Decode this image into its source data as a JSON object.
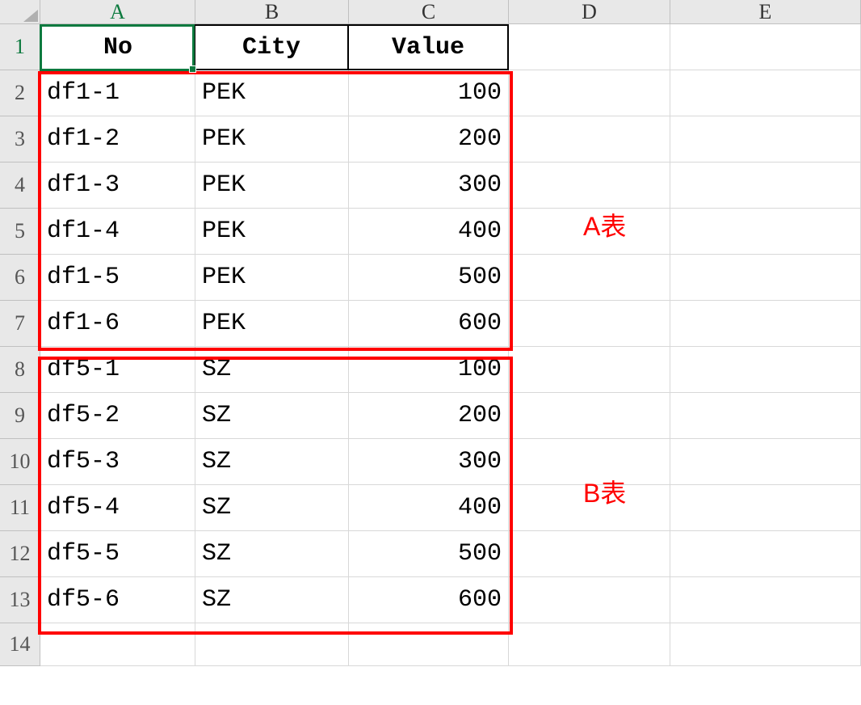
{
  "columns": [
    "A",
    "B",
    "C",
    "D",
    "E"
  ],
  "activeColumn": "A",
  "activeRow": 1,
  "headers": {
    "no": "No",
    "city": "City",
    "value": "Value"
  },
  "rows": [
    {
      "rownum": "1"
    },
    {
      "rownum": "2",
      "no": "df1-1",
      "city": "PEK",
      "value": "100"
    },
    {
      "rownum": "3",
      "no": "df1-2",
      "city": "PEK",
      "value": "200"
    },
    {
      "rownum": "4",
      "no": "df1-3",
      "city": "PEK",
      "value": "300"
    },
    {
      "rownum": "5",
      "no": "df1-4",
      "city": "PEK",
      "value": "400"
    },
    {
      "rownum": "6",
      "no": "df1-5",
      "city": "PEK",
      "value": "500"
    },
    {
      "rownum": "7",
      "no": "df1-6",
      "city": "PEK",
      "value": "600"
    },
    {
      "rownum": "8",
      "no": "df5-1",
      "city": "SZ",
      "value": "100"
    },
    {
      "rownum": "9",
      "no": "df5-2",
      "city": "SZ",
      "value": "200"
    },
    {
      "rownum": "10",
      "no": "df5-3",
      "city": "SZ",
      "value": "300"
    },
    {
      "rownum": "11",
      "no": "df5-4",
      "city": "SZ",
      "value": "400"
    },
    {
      "rownum": "12",
      "no": "df5-5",
      "city": "SZ",
      "value": "500"
    },
    {
      "rownum": "13",
      "no": "df5-6",
      "city": "SZ",
      "value": "600"
    },
    {
      "rownum": "14"
    }
  ],
  "annotations": {
    "labelA": "A表",
    "labelB": "B表"
  }
}
